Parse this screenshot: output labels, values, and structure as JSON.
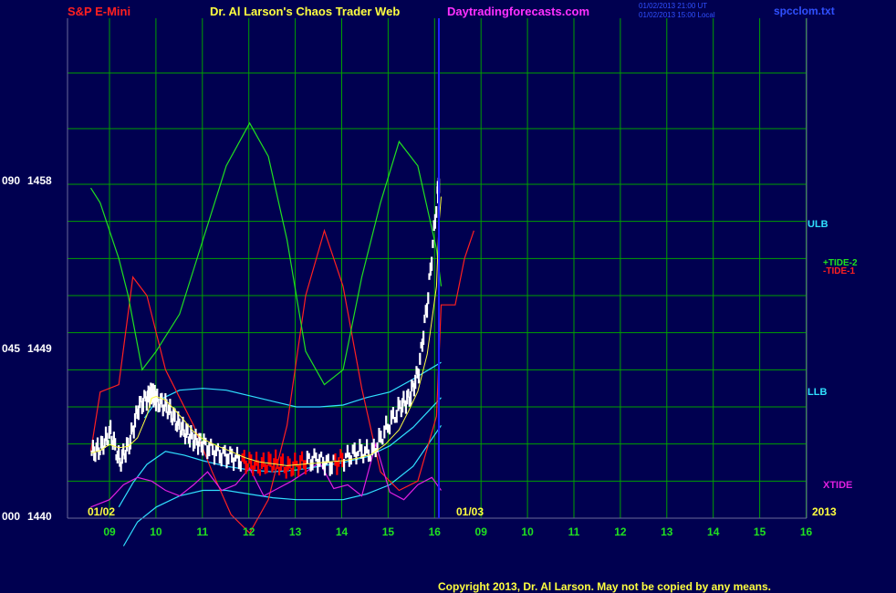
{
  "header": {
    "symbol": "S&P E-Mini",
    "title": "Dr. Al Larson's Chaos Trader Web",
    "site": "Daytradingforecasts.com",
    "time_ut": "01/02/2013 21:00 UT",
    "time_local": "01/02/2013 15:00 Local",
    "file": "spcclom.txt"
  },
  "footer": {
    "copyright": "Copyright 2013, Dr. Al Larson. May not be copied by any means."
  },
  "colors": {
    "background": "#000050",
    "grid": "#00a000",
    "frame": "#6a6a9a",
    "tide1": "#ff2020",
    "tide2": "#20e020",
    "band": "#30e0ff",
    "xtide": "#e020e0",
    "price": "#ffffff",
    "price_down": "#ff0000",
    "ma": "#ffff40",
    "now_line": "#2020ff"
  },
  "chart_data": {
    "type": "line",
    "title": "S&P E-Mini",
    "y_axis_labels": [
      {
        "deg": "090",
        "price": "1458"
      },
      {
        "deg": "045",
        "price": "1449"
      },
      {
        "deg": "000",
        "price": "1440"
      }
    ],
    "ylim": [
      1440,
      1458
    ],
    "x_ticks": [
      "09",
      "10",
      "11",
      "12",
      "13",
      "14",
      "15",
      "16",
      "09",
      "10",
      "11",
      "12",
      "13",
      "14",
      "15",
      "16"
    ],
    "date_labels": [
      "01/02",
      "01/03",
      "2013"
    ],
    "xlim": [
      8.6,
      16.8
    ],
    "series_labels": {
      "ulb": "ULB",
      "llb": "LLB",
      "tide2": "+TIDE-2",
      "tide1": "-TIDE-1",
      "xtide": "XTIDE"
    },
    "series": [
      {
        "name": "ULB",
        "x": [
          9.75,
          10,
          10.5,
          11,
          11.5,
          12,
          12.5,
          13,
          13.5,
          14,
          14.5,
          15,
          15.5,
          16.1
        ],
        "y": [
          1445.4,
          1446.3,
          1446.9,
          1447.0,
          1446.9,
          1446.6,
          1446.3,
          1446.0,
          1446.0,
          1446.1,
          1446.5,
          1446.8,
          1447.5,
          1448.4
        ]
      },
      {
        "name": "LLB",
        "x": [
          9.2,
          9.5,
          9.8,
          10.2,
          10.6,
          11,
          11.5,
          12,
          12.5,
          13,
          13.5,
          14,
          14.5,
          15,
          15.5,
          16.1
        ],
        "y": [
          1440.6,
          1441.9,
          1442.9,
          1443.6,
          1443.4,
          1443.1,
          1442.8,
          1442.6,
          1442.5,
          1442.6,
          1442.8,
          1443.0,
          1443.3,
          1443.9,
          1444.9,
          1446.5
        ]
      },
      {
        "name": "LLB-outer",
        "x": [
          9.3,
          9.6,
          10,
          10.5,
          11,
          11.5,
          12,
          12.5,
          13,
          13.5,
          14,
          14.5,
          15,
          15.5,
          16.1
        ],
        "y": [
          1438.5,
          1439.8,
          1440.6,
          1441.2,
          1441.5,
          1441.5,
          1441.3,
          1441.1,
          1441.0,
          1441.0,
          1441.0,
          1441.3,
          1441.8,
          1442.8,
          1445.0
        ]
      },
      {
        "name": "-TIDE-1",
        "x": [
          8.6,
          8.8,
          9.2,
          9.5,
          9.8,
          10.2,
          10.8,
          11.2,
          11.6,
          12,
          12.4,
          12.8,
          13.2,
          13.6,
          14,
          14.4,
          14.8,
          15.2,
          15.6,
          16.0,
          16.1,
          16.4,
          16.6,
          16.8
        ],
        "y": [
          1443.6,
          1446.8,
          1447.2,
          1453.0,
          1452.0,
          1448.0,
          1445.0,
          1442.5,
          1440.2,
          1439.2,
          1441.0,
          1445.0,
          1452.0,
          1455.5,
          1452.5,
          1447.0,
          1442.5,
          1441.5,
          1442.0,
          1445.5,
          1451.5,
          1451.5,
          1454.0,
          1455.5
        ]
      },
      {
        "name": "+TIDE-2",
        "x": [
          8.6,
          8.8,
          9.2,
          9.4,
          9.7,
          10,
          10.5,
          11,
          11.5,
          12,
          12.4,
          12.8,
          13.2,
          13.6,
          14,
          14.4,
          14.8,
          15.2,
          15.6,
          16.0,
          16.1
        ],
        "y": [
          1457.8,
          1457.0,
          1454.0,
          1452.0,
          1448.0,
          1449.0,
          1451.0,
          1455.0,
          1459.0,
          1461.3,
          1459.5,
          1455.0,
          1449.0,
          1447.2,
          1448.0,
          1453.0,
          1457.0,
          1460.3,
          1459.0,
          1454.5,
          1452.5
        ]
      },
      {
        "name": "XTIDE",
        "x": [
          8.6,
          9,
          9.3,
          9.6,
          9.9,
          10.2,
          10.5,
          10.8,
          11.1,
          11.4,
          11.7,
          12,
          12.3,
          12.6,
          12.9,
          13.2,
          13.5,
          13.8,
          14.1,
          14.4,
          14.7,
          15,
          15.3,
          15.6,
          15.9,
          16.1
        ],
        "y": [
          1440.6,
          1441.0,
          1441.8,
          1442.2,
          1442.0,
          1441.5,
          1441.2,
          1441.8,
          1442.5,
          1441.5,
          1441.8,
          1442.7,
          1441.2,
          1441.6,
          1442.0,
          1442.5,
          1443.0,
          1441.6,
          1441.8,
          1441.2,
          1444.0,
          1441.4,
          1441.0,
          1441.8,
          1442.2,
          1441.5
        ]
      },
      {
        "name": "price",
        "x": [
          8.6,
          8.8,
          9.0,
          9.2,
          9.4,
          9.6,
          9.8,
          9.9,
          10.0,
          10.2,
          10.4,
          10.6,
          10.8,
          11.0,
          11.3,
          11.6,
          11.9,
          12.2,
          12.5,
          12.8,
          13.1,
          13.4,
          13.7,
          14.0,
          14.3,
          14.6,
          14.9,
          15.2,
          15.4,
          15.6,
          15.8,
          16.0,
          16.05,
          16.1
        ],
        "y": [
          1443.5,
          1443.8,
          1444.6,
          1443.0,
          1444.0,
          1446.0,
          1446.6,
          1446.8,
          1446.3,
          1446.0,
          1445.2,
          1444.6,
          1444.2,
          1444.0,
          1443.5,
          1443.3,
          1443.0,
          1442.8,
          1443.0,
          1442.7,
          1443.0,
          1443.2,
          1442.9,
          1443.2,
          1443.6,
          1443.5,
          1444.8,
          1446.0,
          1446.5,
          1448.0,
          1452.0,
          1457.5,
          1458.0,
          1456.5
        ]
      }
    ]
  }
}
